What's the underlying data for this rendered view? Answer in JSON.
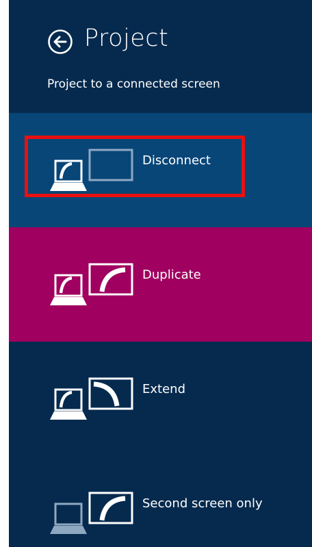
{
  "header": {
    "title": "Project",
    "subtitle": "Project to a connected screen"
  },
  "options": [
    {
      "label": "Disconnect",
      "bg": "#084678",
      "selected": true
    },
    {
      "label": "Duplicate",
      "bg": "#a0005f",
      "selected": false
    },
    {
      "label": "Extend",
      "bg": "#062a4e",
      "selected": false
    },
    {
      "label": "Second screen only",
      "bg": "#062a4e",
      "selected": false
    }
  ],
  "colors": {
    "panel_bg": "#062a4e",
    "selection_outline": "#e81010"
  }
}
